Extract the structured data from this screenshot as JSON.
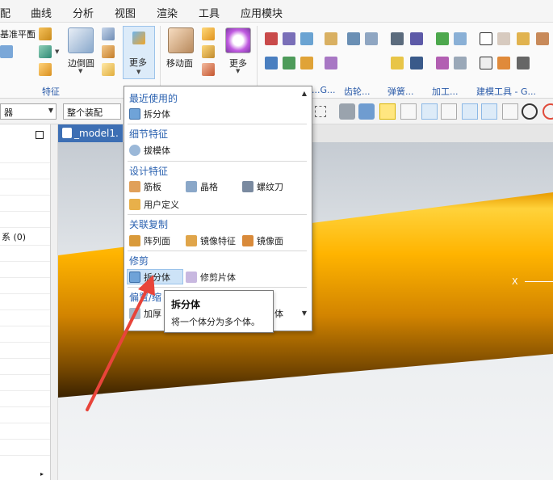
{
  "menubar": {
    "items": [
      "配",
      "曲线",
      "分析",
      "视图",
      "渲染",
      "工具",
      "应用模块"
    ]
  },
  "ribbon": {
    "partial_label": "基准平面",
    "edge_blend_label": "边倒圆",
    "more_label": "更多",
    "move_face_label": "移动面",
    "more2_label": "更多",
    "group_feature": "特征",
    "group_gear": "齿轮...",
    "group_spring": "弹簧...",
    "group_machining": "加工...",
    "group_modeling_tools": "建模工具 - G...",
    "group_partial": "...G..."
  },
  "toolbar2": {
    "filter_combo": "器",
    "assembly_combo": "整个装配"
  },
  "left_panel": {
    "partial_text": "系 (0)"
  },
  "viewport": {
    "tab_label": "_model1.",
    "axis_label": "X"
  },
  "dropdown": {
    "sections": [
      {
        "heading": "最近使用的",
        "items": [
          "拆分体"
        ]
      },
      {
        "heading": "细节特征",
        "items": [
          "拔模体"
        ]
      },
      {
        "heading": "设计特征",
        "items": [
          "筋板",
          "晶格",
          "螺纹刀",
          "用户定义"
        ]
      },
      {
        "heading": "关联复制",
        "items": [
          "阵列面",
          "镜像特征",
          "镜像面"
        ]
      },
      {
        "heading": "修剪",
        "items": [
          "拆分体",
          "修剪片体"
        ]
      },
      {
        "heading": "偏置/缩",
        "items": [
          "加厚",
          "体"
        ]
      }
    ]
  },
  "tooltip": {
    "title": "拆分体",
    "description": "将一个体分为多个体。"
  },
  "colors": {
    "accent_blue": "#2b62b0",
    "highlight": "#cde3f7",
    "cylinder_orange": "#f5a800",
    "annotation_red": "#e8443a"
  }
}
